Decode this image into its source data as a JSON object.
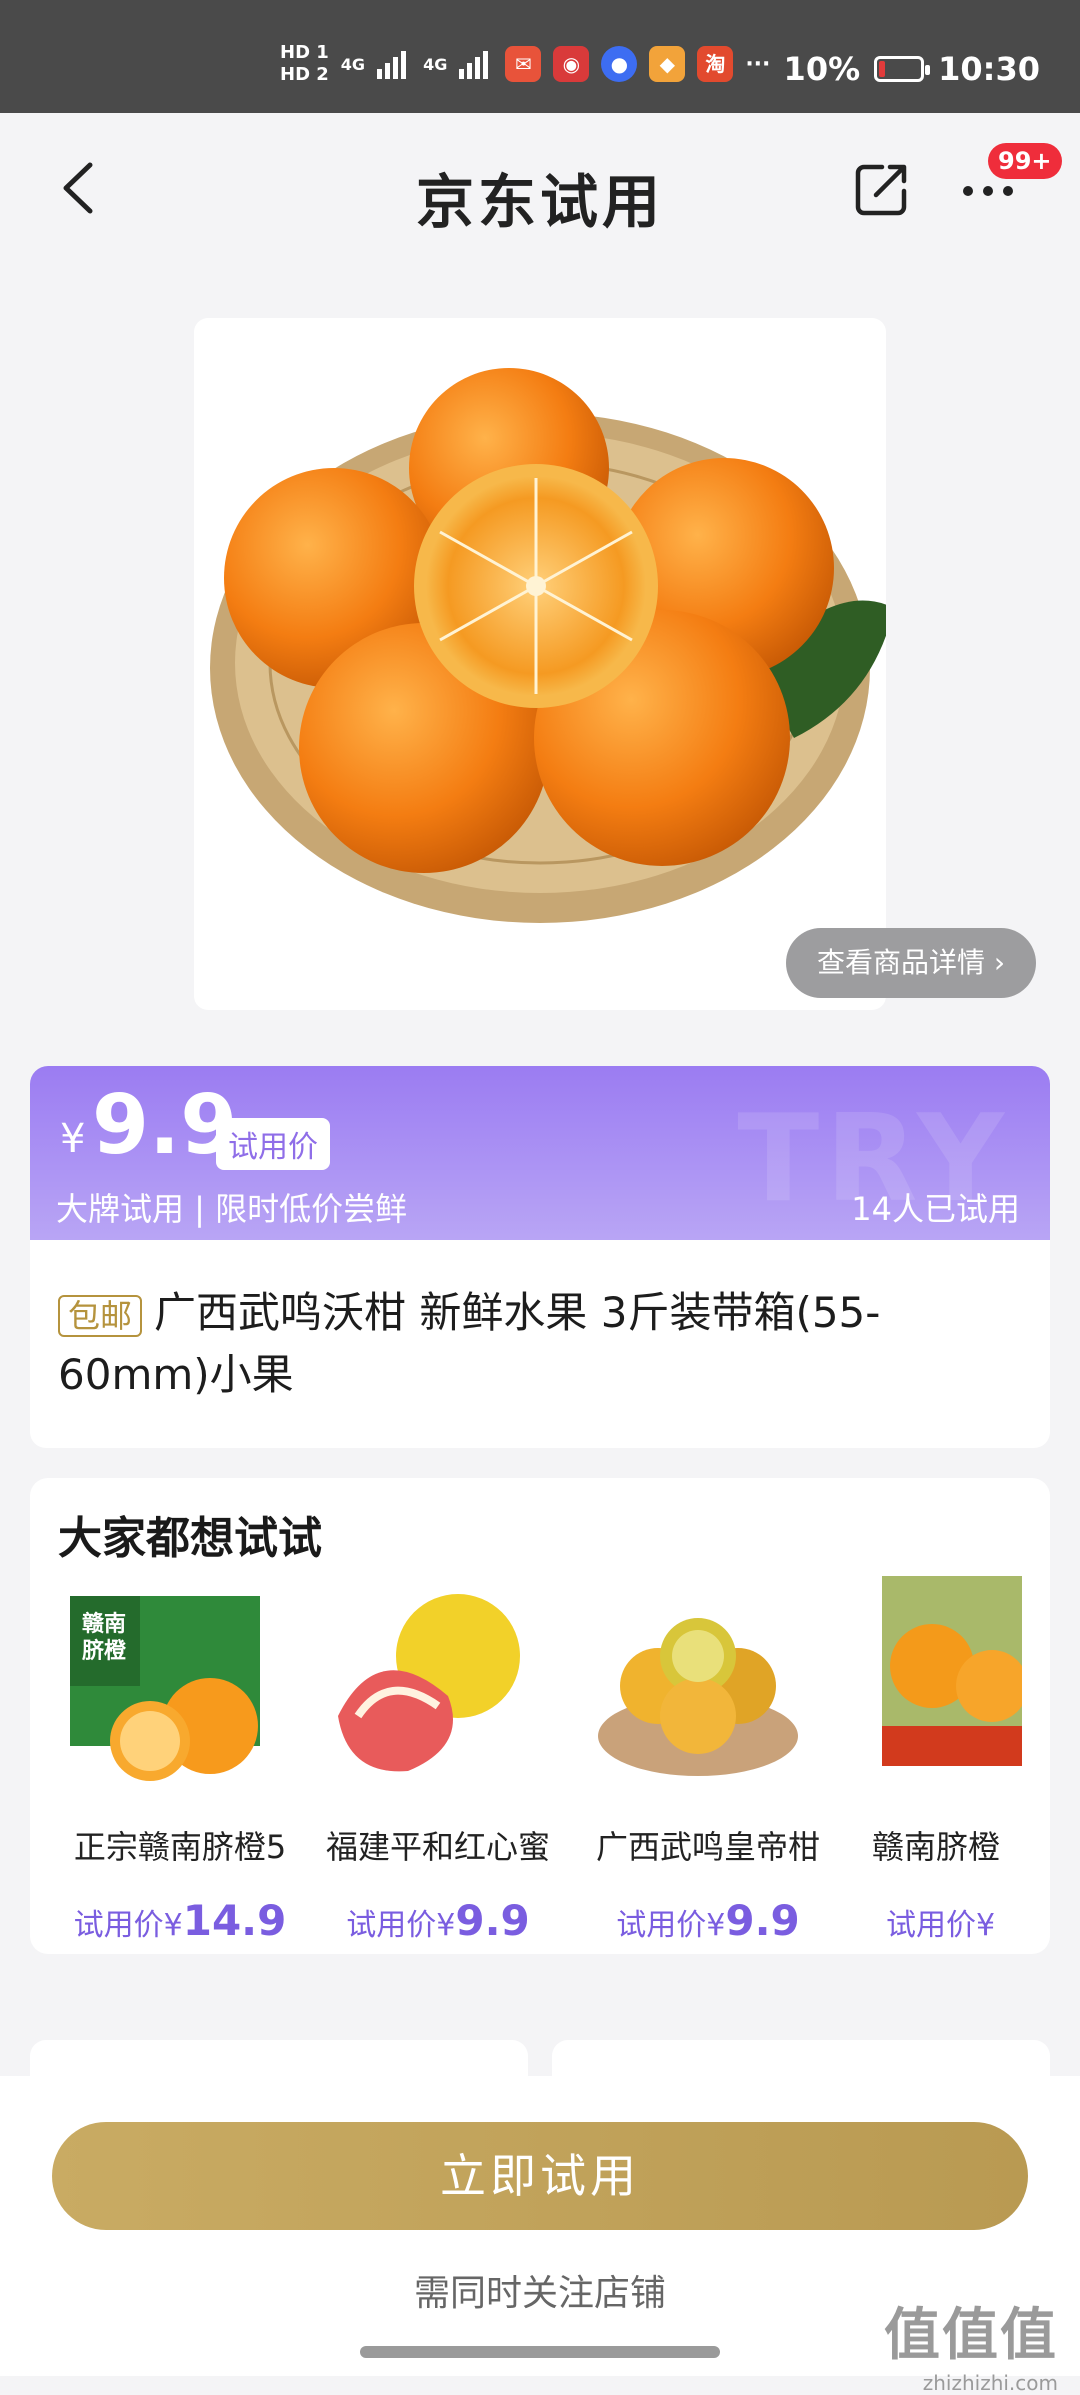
{
  "status_bar": {
    "hd1": "HD 1",
    "hd2": "HD 2",
    "network1": "4G",
    "network2": "4G",
    "app_icon_taobao": "淘",
    "more_dots": "···",
    "battery": "10%",
    "time": "10:30"
  },
  "nav": {
    "title": "京东试用",
    "badge": "99+"
  },
  "product": {
    "detail_link": "查看商品详情 ›",
    "yen": "¥",
    "price": "9.9",
    "price_tag": "试用价",
    "slogan": "大牌试用 | 限时低价尝鲜",
    "tried_count": "14人已试用",
    "postage_tag": "包邮",
    "title": "广西武鸣沃柑 新鲜水果 3斤装带箱(55-60mm)小果"
  },
  "recommend": {
    "title": "大家都想试试",
    "items": [
      {
        "name": "正宗赣南脐橙5",
        "price_label": "试用价¥",
        "price": "14.9"
      },
      {
        "name": "福建平和红心蜜",
        "price_label": "试用价¥",
        "price": "9.9"
      },
      {
        "name": "广西武鸣皇帝柑",
        "price_label": "试用价¥",
        "price": "9.9"
      },
      {
        "name": "赣南脐橙",
        "price_label": "试用价¥",
        "price": ""
      }
    ]
  },
  "bottom": {
    "cta": "立即试用",
    "note": "需同时关注店铺"
  },
  "watermark": {
    "big": "值值值",
    "small": "zhizhizhi.com"
  }
}
